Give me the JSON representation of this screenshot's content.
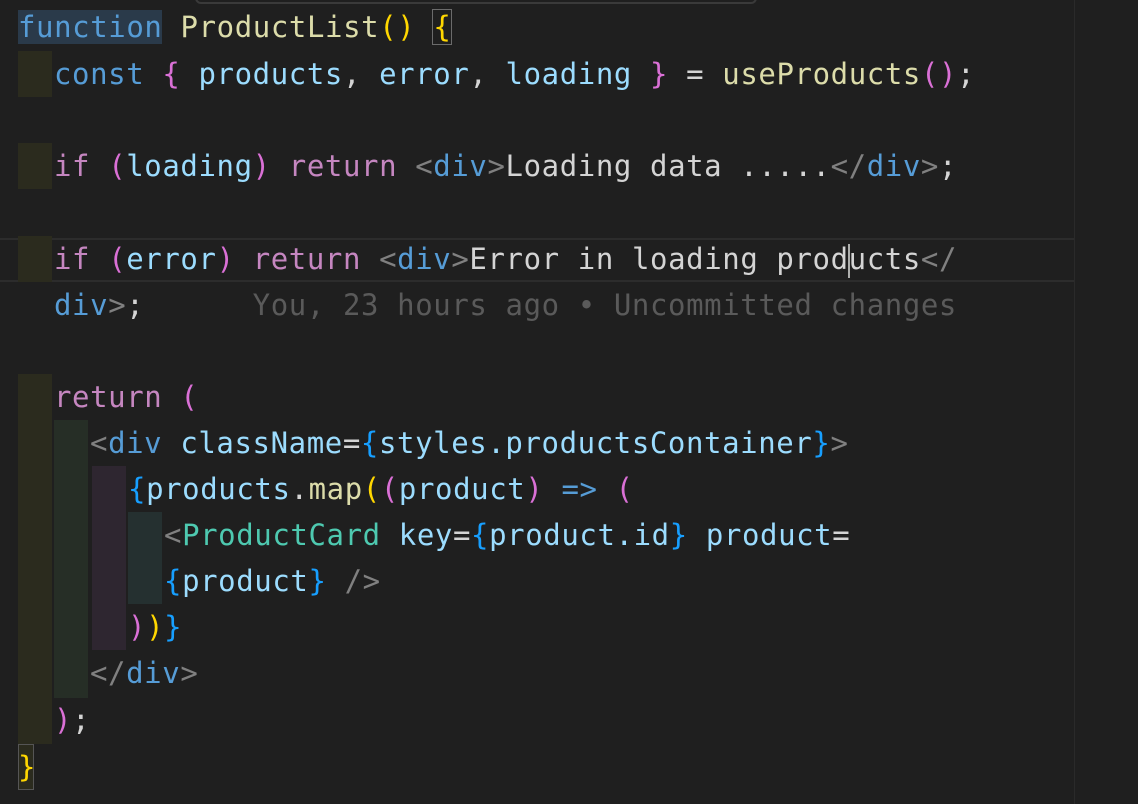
{
  "editor": {
    "lines": {
      "l1": {
        "kw": "function",
        "name": "ProductList",
        "parens": "()",
        "brace": "{"
      },
      "l2": {
        "kw": "const",
        "open": "{",
        "v1": "products",
        "c1": ",",
        "v2": "error",
        "c2": ",",
        "v3": "loading",
        "close": "}",
        "eq": "=",
        "call": "useProducts",
        "parens": "()",
        "semi": ";"
      },
      "l3": {
        "kw": "if",
        "po": "(",
        "cond": "loading",
        "pc": ")",
        "ret": "return",
        "lt": "<",
        "tag": "div",
        "gt": ">",
        "text": "Loading data .....",
        "endopen": "</",
        "endtag": "div",
        "endgt": ">",
        "semi": ";"
      },
      "l4": {
        "kw": "if",
        "po": "(",
        "cond": "error",
        "pc": ")",
        "ret": "return",
        "lt": "<",
        "tag": "div",
        "gt": ">",
        "text_a": "Error in loading prod",
        "text_b": "ucts",
        "endopen": "</"
      },
      "l5": {
        "endtag": "div",
        "endgt": ">",
        "semi": ";",
        "blame": "You, 23 hours ago • Uncommitted changes"
      },
      "l6": {
        "ret": "return",
        "paren": "("
      },
      "l7": {
        "lt": "<",
        "tag": "div",
        "attr": "className",
        "eq": "=",
        "bo": "{",
        "expr": "styles.productsContainer",
        "bc": "}",
        "gt": ">"
      },
      "l8": {
        "bo": "{",
        "obj": "products",
        "dot": ".",
        "method": "map",
        "po": "(",
        "pi": "(",
        "param": "product",
        "pic": ")",
        "arrow": "=>",
        "po2": "("
      },
      "l9": {
        "lt": "<",
        "comp": "ProductCard",
        "a1": "key",
        "eq1": "=",
        "bo1": "{",
        "e1": "product.id",
        "bc1": "}",
        "a2": "product",
        "eq2": "="
      },
      "l10": {
        "bo": "{",
        "e": "product",
        "bc": "}",
        "selfclose": "/>"
      },
      "l11": {
        "p1": ")",
        "p2": ")",
        "bc": "}"
      },
      "l12": {
        "endopen": "</",
        "tag": "div",
        "gt": ">"
      },
      "l13": {
        "paren": ")",
        "semi": ";"
      },
      "l14": {
        "brace": "}"
      }
    }
  }
}
